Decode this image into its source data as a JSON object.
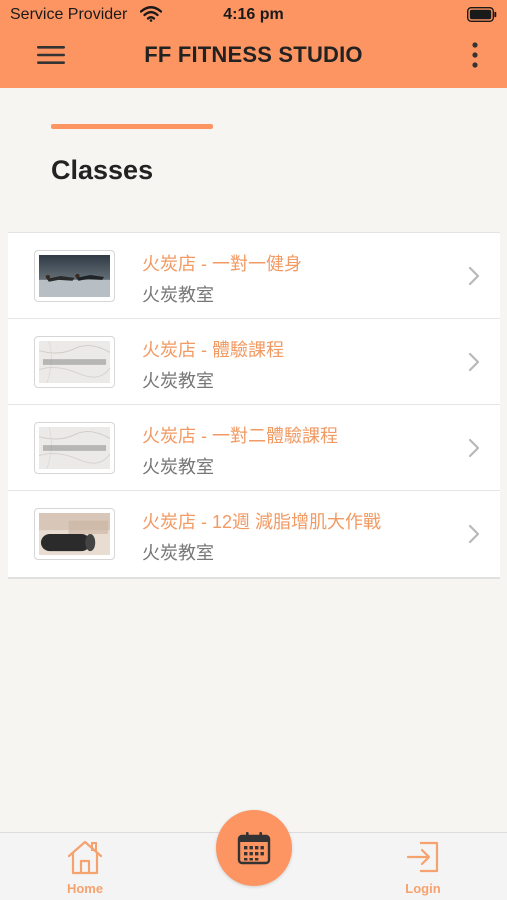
{
  "status_bar": {
    "carrier": "Service Provider",
    "time": "4:16 pm"
  },
  "nav": {
    "title": "FF FITNESS STUDIO",
    "menu_icon": "hamburger-menu-icon",
    "more_icon": "more-vertical-icon"
  },
  "section": {
    "title": "Classes"
  },
  "classes": [
    {
      "title": "火炭店 - 一對一健身",
      "subtitle": "火炭教室",
      "thumbnail": "workout-photo"
    },
    {
      "title": "火炭店 - 體驗課程",
      "subtitle": "火炭教室",
      "thumbnail": "marble-logo"
    },
    {
      "title": "火炭店 - 一對二體驗課程",
      "subtitle": "火炭教室",
      "thumbnail": "marble-logo"
    },
    {
      "title": "火炭店 - 12週 減脂增肌大作戰",
      "subtitle": "火炭教室",
      "thumbnail": "foam-roller-photo"
    }
  ],
  "tab_bar": {
    "home_label": "Home",
    "login_label": "Login",
    "center_icon": "calendar-icon"
  },
  "colors": {
    "accent": "#fd9563",
    "class_title": "#f29a63",
    "background": "#f6f5f2"
  }
}
